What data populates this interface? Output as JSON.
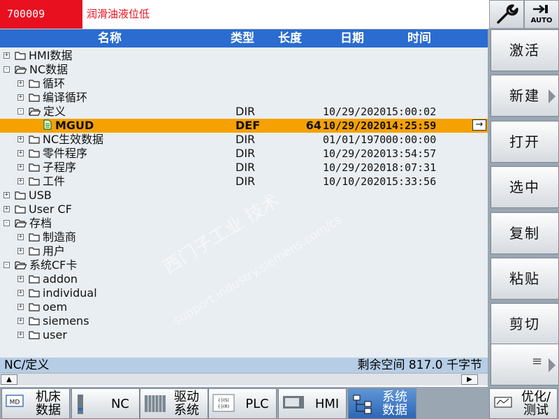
{
  "alarm": {
    "code": "700009",
    "text": "润滑油液位低"
  },
  "top_icons": {
    "wrench": "wrench-icon",
    "auto": "AUTO"
  },
  "columns": {
    "name": "名称",
    "type": "类型",
    "length": "长度",
    "date": "日期",
    "time": "时间"
  },
  "rows": [
    {
      "name": "HMI数据",
      "level": 0,
      "exp": "+",
      "type": "",
      "len": "",
      "date": "",
      "time": ""
    },
    {
      "name": "NC数据",
      "level": 0,
      "exp": "-",
      "type": "",
      "len": "",
      "date": "",
      "time": "",
      "open": true
    },
    {
      "name": "循环",
      "level": 1,
      "exp": "+",
      "type": "",
      "len": "",
      "date": "",
      "time": ""
    },
    {
      "name": "编译循环",
      "level": 1,
      "exp": "+",
      "type": "",
      "len": "",
      "date": "",
      "time": ""
    },
    {
      "name": "定义",
      "level": 1,
      "exp": "-",
      "type": "DIR",
      "len": "",
      "date": "10/29/2020",
      "time": "15:00:02",
      "open": true
    },
    {
      "name": "MGUD",
      "level": 2,
      "exp": "",
      "type": "DEF",
      "len": "64",
      "date": "10/29/2020",
      "time": "14:25:59",
      "file": true,
      "selected": true
    },
    {
      "name": "NC生效数据",
      "level": 1,
      "exp": "+",
      "type": "DIR",
      "len": "",
      "date": "01/01/1970",
      "time": "00:00:00"
    },
    {
      "name": "零件程序",
      "level": 1,
      "exp": "+",
      "type": "DIR",
      "len": "",
      "date": "10/29/2020",
      "time": "13:54:57"
    },
    {
      "name": "子程序",
      "level": 1,
      "exp": "+",
      "type": "DIR",
      "len": "",
      "date": "10/29/2020",
      "time": "18:07:31"
    },
    {
      "name": "工件",
      "level": 1,
      "exp": "+",
      "type": "DIR",
      "len": "",
      "date": "10/10/2020",
      "time": "15:33:56"
    },
    {
      "name": "USB",
      "level": 0,
      "exp": "+",
      "type": "",
      "len": "",
      "date": "",
      "time": ""
    },
    {
      "name": "User CF",
      "level": 0,
      "exp": "+",
      "type": "",
      "len": "",
      "date": "",
      "time": ""
    },
    {
      "name": "存档",
      "level": 0,
      "exp": "-",
      "type": "",
      "len": "",
      "date": "",
      "time": "",
      "open": true
    },
    {
      "name": "制造商",
      "level": 1,
      "exp": "+",
      "type": "",
      "len": "",
      "date": "",
      "time": ""
    },
    {
      "name": "用户",
      "level": 1,
      "exp": "+",
      "type": "",
      "len": "",
      "date": "",
      "time": ""
    },
    {
      "name": "系统CF卡",
      "level": 0,
      "exp": "-",
      "type": "",
      "len": "",
      "date": "",
      "time": "",
      "open": true
    },
    {
      "name": "addon",
      "level": 1,
      "exp": "+",
      "type": "",
      "len": "",
      "date": "",
      "time": ""
    },
    {
      "name": "individual",
      "level": 1,
      "exp": "+",
      "type": "",
      "len": "",
      "date": "",
      "time": ""
    },
    {
      "name": "oem",
      "level": 1,
      "exp": "+",
      "type": "",
      "len": "",
      "date": "",
      "time": ""
    },
    {
      "name": "siemens",
      "level": 1,
      "exp": "+",
      "type": "",
      "len": "",
      "date": "",
      "time": ""
    },
    {
      "name": "user",
      "level": 1,
      "exp": "+",
      "type": "",
      "len": "",
      "date": "",
      "time": ""
    }
  ],
  "status": {
    "path": "NC/定义",
    "free_space": "剩余空间 817.0 千字节"
  },
  "softkeys": [
    "激活",
    "新建",
    "打开",
    "选中",
    "复制",
    "粘贴",
    "剪切"
  ],
  "bottom_tabs": [
    {
      "label": "机床\n数据",
      "icon": "md-icon"
    },
    {
      "label": "NC",
      "icon": "nc-icon"
    },
    {
      "label": "驱动\n系统",
      "icon": "drive-icon"
    },
    {
      "label": "PLC",
      "icon": "plc-icon"
    },
    {
      "label": "HMI",
      "icon": "hmi-icon"
    },
    {
      "label": "系统\n数据",
      "icon": "system-data-icon",
      "active": true
    },
    {
      "label": "优化/\n测试",
      "icon": "optimize-icon"
    }
  ],
  "watermark": {
    "main": "西门子工业  技术",
    "sub": "support.industry.siemens.com/cs"
  },
  "colors": {
    "alarm": "#e8101f",
    "header": "#2a6cd0",
    "selection": "#f5a100",
    "list_bg": "#e9eef2",
    "status_bg": "#b6cde6"
  }
}
